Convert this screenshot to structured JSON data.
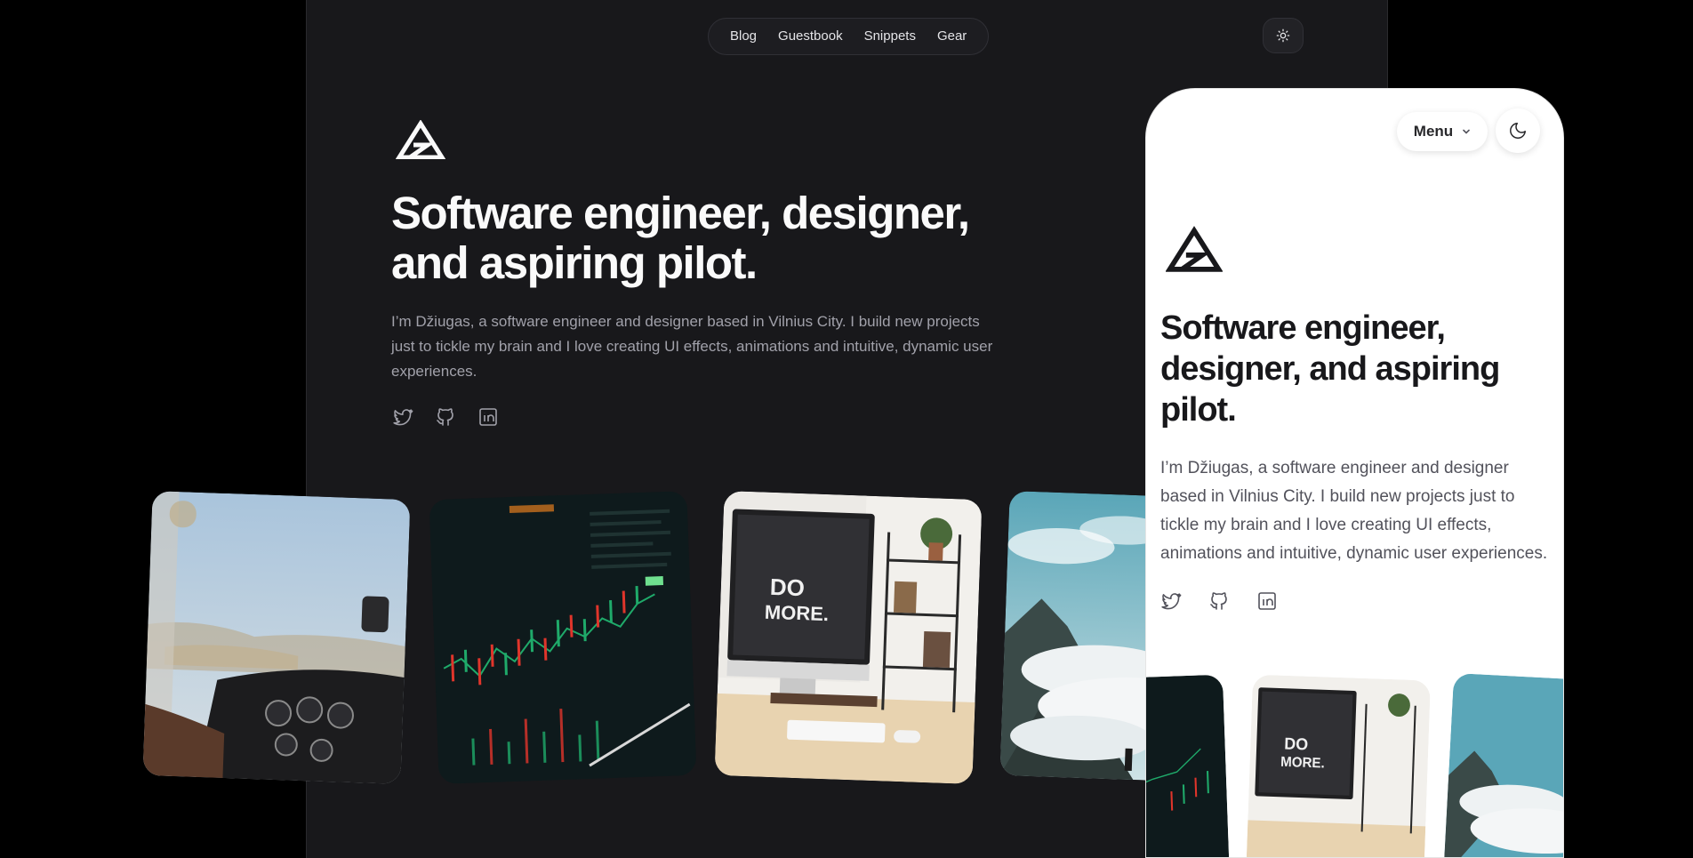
{
  "nav": {
    "items": [
      "Blog",
      "Guestbook",
      "Snippets",
      "Gear"
    ]
  },
  "hero": {
    "title": "Software engineer, designer, and aspiring pilot.",
    "description": "I’m Džiugas, a software engineer and designer based in Vilnius City. I build new projects just to tickle my brain and I love creating UI effects, animations and intuitive, dynamic user experiences."
  },
  "socials": [
    "twitter-icon",
    "github-icon",
    "linkedin-icon"
  ],
  "photos": [
    "cockpit",
    "stock-chart",
    "do-more-desk",
    "mountain-clouds"
  ],
  "mobile": {
    "menu_label": "Menu",
    "title": "Software engineer, designer, and aspiring pilot.",
    "description": "I’m Džiugas, a software engineer and designer based in Vilnius City. I build new projects just to tickle my brain and I love creating UI effects, animations and intuitive, dynamic user experiences."
  },
  "colors": {
    "dark_bg": "#18181b",
    "page_bg": "#000000",
    "light_bg": "#ffffff"
  }
}
